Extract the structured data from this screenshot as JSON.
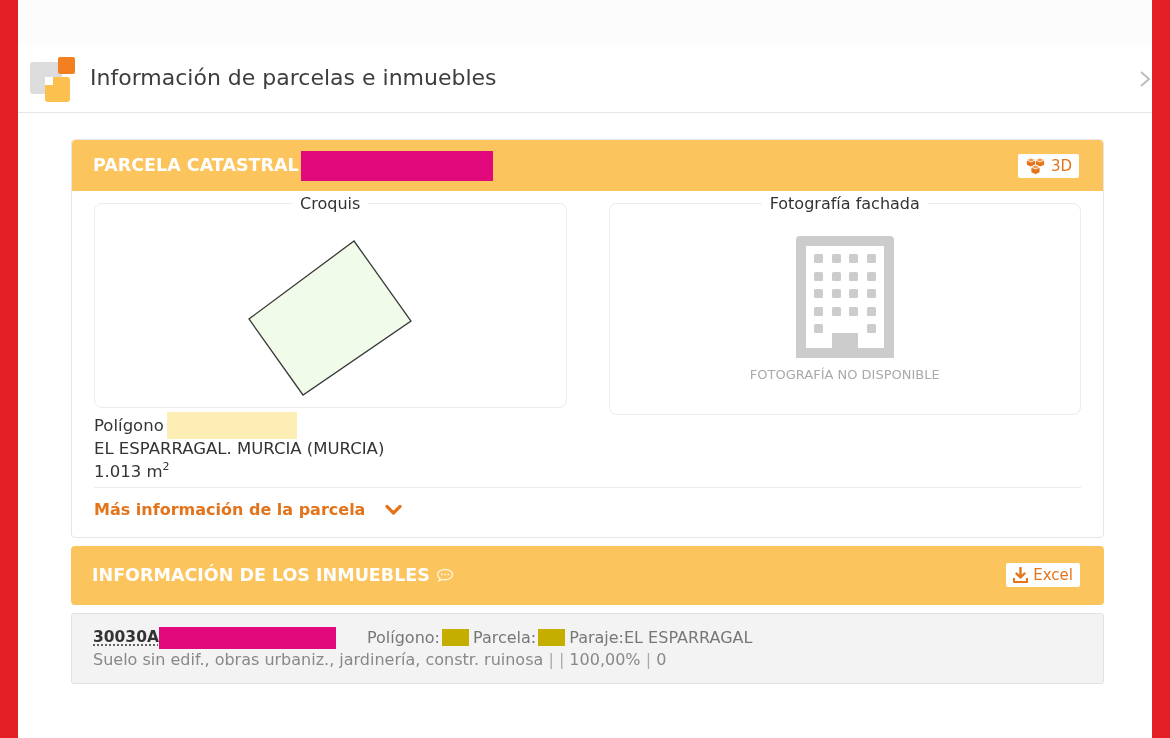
{
  "panel": {
    "title": "Información de parcelas e inmuebles"
  },
  "parcel_card": {
    "title": "PARCELA CATASTRAL",
    "title_redacted": true,
    "button_3d": "3D",
    "sketch": {
      "legend": "Croquis"
    },
    "facade_photo": {
      "legend": "Fotografía fachada",
      "message": "FOTOGRAFÍA NO DISPONIBLE"
    },
    "details": [
      {
        "text": "Polígono",
        "redacted": true
      },
      {
        "text": "EL ESPARRAGAL. MURCIA (MURCIA)",
        "redacted": false
      },
      {
        "text": "1.013 m$^{2}$",
        "redacted": false
      }
    ],
    "more_link": {
      "label": "Más información de la parcela",
      "expanded": false
    }
  },
  "properties_card": {
    "title": "INFORMACIÓN DE LOS INMUEBLES",
    "excel_button": "Excel",
    "items": [
      {
        "reference": "30030A",
        "reference_redacted": true,
        "location": [
          {
            "text": "Polígono:",
            "redacted": true
          },
          {
            "text": "Parcela:",
            "redacted": true
          },
          {
            "text": "Paraje:EL ESPARRAGAL",
            "redacted": false
          }
        ],
        "usage": [
          {
            "kind": "text",
            "text": "Suelo sin edif., obras urbaniz., jardinería, constr. ruinosa"
          },
          {
            "kind": "separator",
            "text": "|"
          },
          {
            "kind": "separator",
            "text": "|"
          },
          {
            "kind": "text",
            "text": "100,00%"
          },
          {
            "kind": "separator",
            "text": "|"
          },
          {
            "kind": "text",
            "text": "0"
          }
        ]
      }
    ]
  }
}
